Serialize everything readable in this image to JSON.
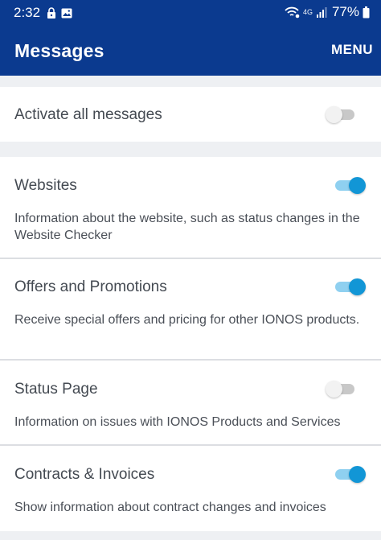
{
  "status_bar": {
    "time": "2:32",
    "network": "4G",
    "battery": "77%",
    "icons": [
      "lock-icon",
      "image-icon",
      "wifi-call-icon",
      "signal-icon",
      "battery-icon"
    ]
  },
  "app_bar": {
    "title": "Messages",
    "menu_label": "MENU"
  },
  "activate_all": {
    "label": "Activate all messages",
    "enabled": false
  },
  "items": [
    {
      "title": "Websites",
      "description": "Information about the website, such as status changes in the Website Checker",
      "enabled": true
    },
    {
      "title": "Offers and Promotions",
      "description": "Receive special offers and pricing for other IONOS products.",
      "enabled": true
    },
    {
      "title": "Status Page",
      "description": "Information on issues with IONOS Products and Services",
      "enabled": false
    },
    {
      "title": "Contracts & Invoices",
      "description": "Show information about contract changes and invoices",
      "enabled": true
    }
  ],
  "colors": {
    "app_bar": "#0b3a8f",
    "toggle_on": "#1296d6",
    "toggle_on_track": "#8fd0f0",
    "toggle_off": "#f2f2f2",
    "background": "#eef0f3"
  }
}
